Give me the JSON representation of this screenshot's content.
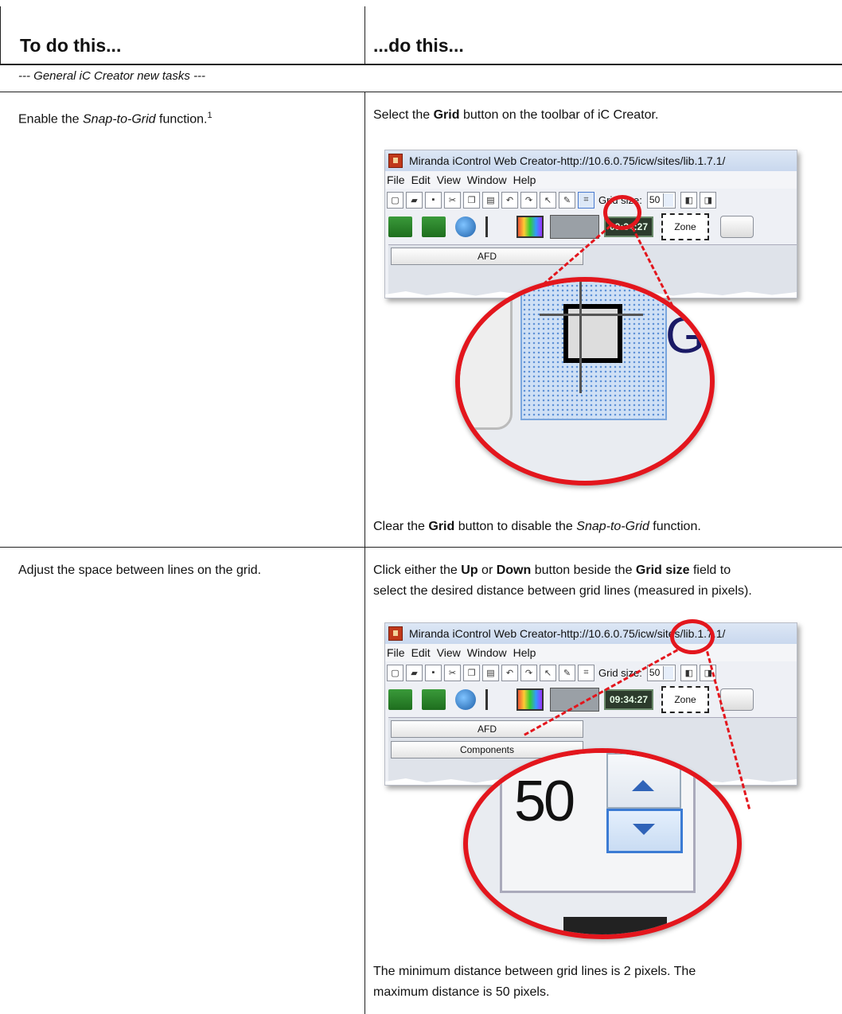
{
  "table": {
    "header_left": "To do this...",
    "header_right": "...do this...",
    "section_label": "--- General iC Creator new tasks ---"
  },
  "row1": {
    "left_pre": "Enable the ",
    "left_italic": "Snap-to-Grid",
    "left_post": " function.",
    "footnote": "1",
    "right_pre": "Select the ",
    "right_bold": "Grid",
    "right_post": " button on the toolbar of iC Creator.",
    "clear_pre": "Clear the ",
    "clear_bold": "Grid",
    "clear_mid": " button to disable the ",
    "clear_italic": "Snap-to-Grid",
    "clear_post": " function."
  },
  "row2": {
    "left": "Adjust the space between lines on the grid.",
    "r_pre": "Click either the ",
    "r_up": "Up",
    "r_or": " or ",
    "r_down": "Down",
    "r_mid": " button beside the ",
    "r_field": "Grid size",
    "r_post1": " field to",
    "r_line2": "select the desired distance between grid lines (measured in pixels).",
    "note_line1": "The minimum distance between grid lines is 2 pixels. The",
    "note_line2": "maximum distance is 50 pixels."
  },
  "screenshot": {
    "title": "Miranda iControl Web Creator-http://10.6.0.75/icw/sites/lib.1.7.1/",
    "menu": [
      "File",
      "Edit",
      "View",
      "Window",
      "Help"
    ],
    "grid_label": "Grid size:",
    "grid_value": "50",
    "clock": "09:34:27",
    "zone": "Zone",
    "panel_tab": "AFD",
    "panel_tab2": "Components",
    "zoom_value": "50",
    "zoom_letter": "G"
  },
  "colors": {
    "accent_red": "#e3161d"
  }
}
